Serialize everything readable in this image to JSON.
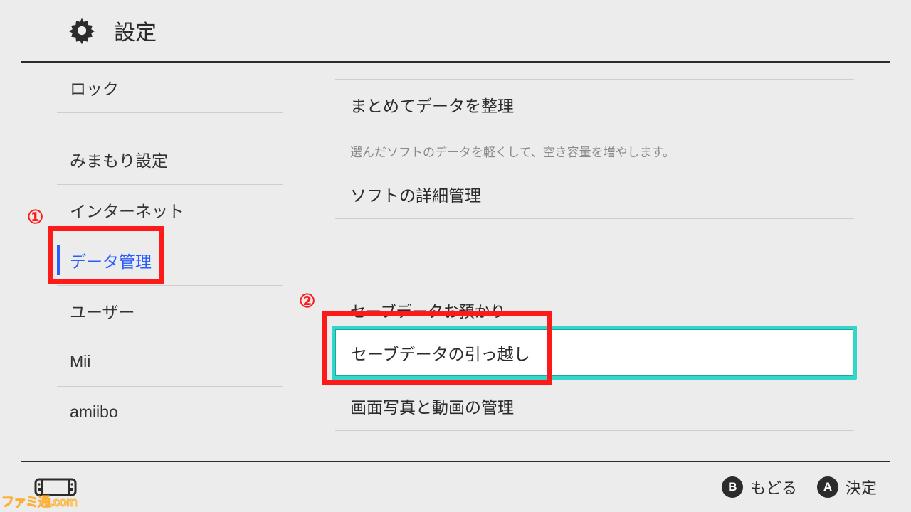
{
  "header": {
    "title": "設定"
  },
  "sidebar": {
    "items": [
      {
        "label": "ロック"
      },
      {
        "label": "みまもり設定"
      },
      {
        "label": "インターネット"
      },
      {
        "label": "データ管理",
        "selected": true
      },
      {
        "label": "ユーザー"
      },
      {
        "label": "Mii"
      },
      {
        "label": "amiibo"
      }
    ]
  },
  "content": {
    "organize": {
      "label": "まとめてデータを整理"
    },
    "organize_desc": "選んだソフトのデータを軽くして、空き容量を増やします。",
    "detail": {
      "label": "ソフトの詳細管理"
    },
    "save_head": "セーブデータお預かり",
    "save_transfer": {
      "label": "セーブデータの引っ越し",
      "cursor": true
    },
    "screenshots": {
      "label": "画面写真と動画の管理"
    }
  },
  "footer": {
    "back_key": "B",
    "back_label": "もどる",
    "ok_key": "A",
    "ok_label": "決定"
  },
  "annotations": {
    "one": "①",
    "two": "②"
  },
  "watermark": "ファミ通.com"
}
